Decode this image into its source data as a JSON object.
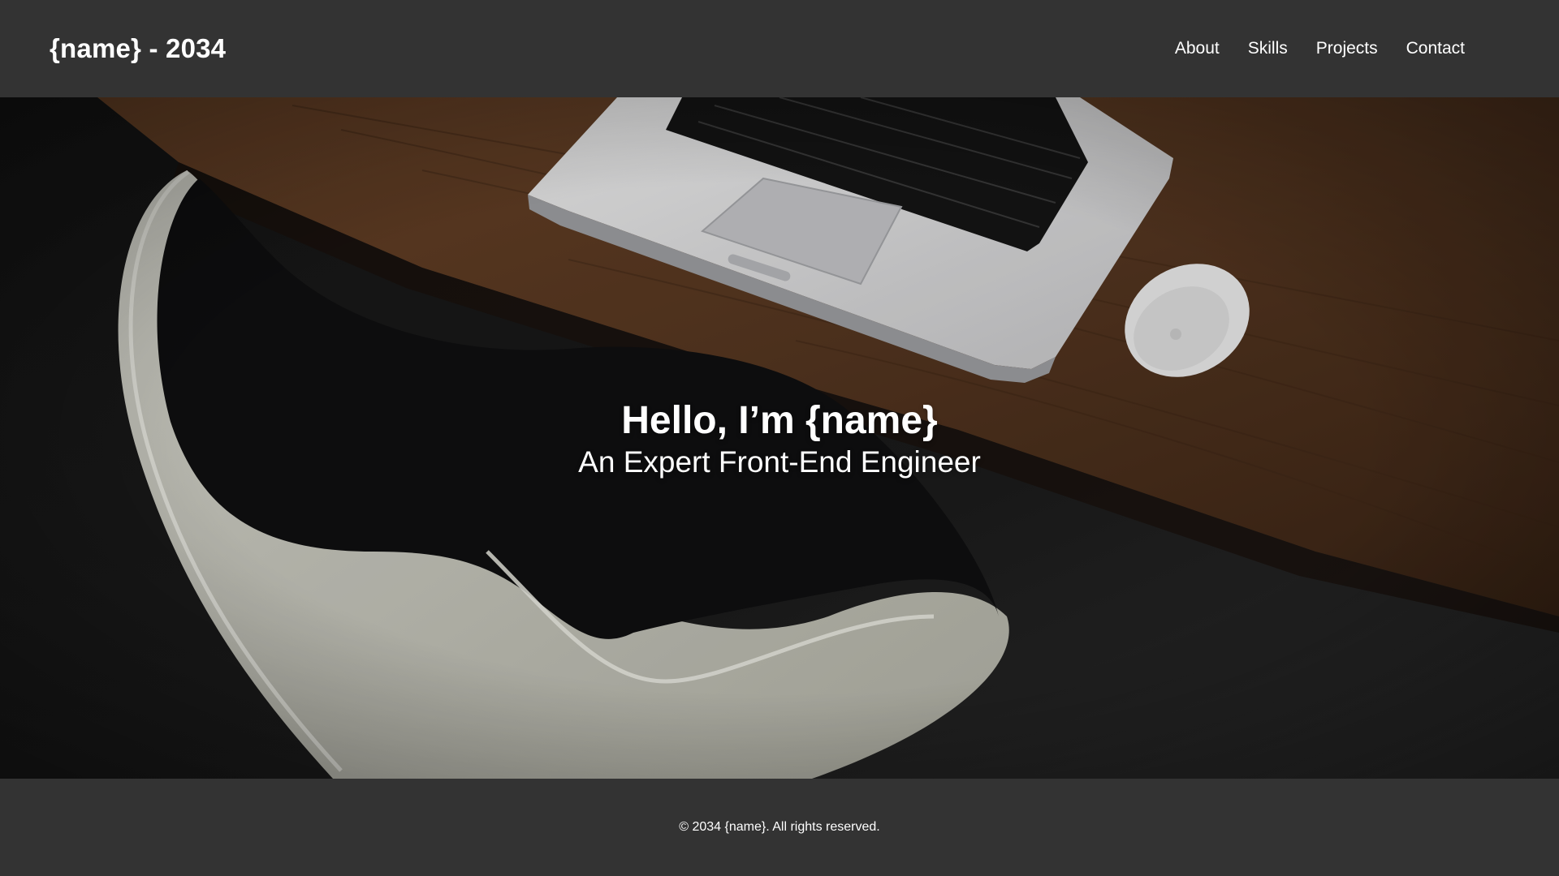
{
  "header": {
    "site_title": "{name} - 2034",
    "nav": [
      {
        "label": "About"
      },
      {
        "label": "Skills"
      },
      {
        "label": "Projects"
      },
      {
        "label": "Contact"
      }
    ]
  },
  "hero": {
    "title": "Hello, I’m {name}",
    "subtitle": "An Expert Front-End Engineer",
    "image_icon": "desk-laptop-photo"
  },
  "footer": {
    "copyright": "© 2034 {name}. All rights reserved."
  },
  "colors": {
    "bar_background": "#333333",
    "text": "#ffffff",
    "desk_wood": "#5a3a22",
    "floor_dark": "#161616"
  }
}
